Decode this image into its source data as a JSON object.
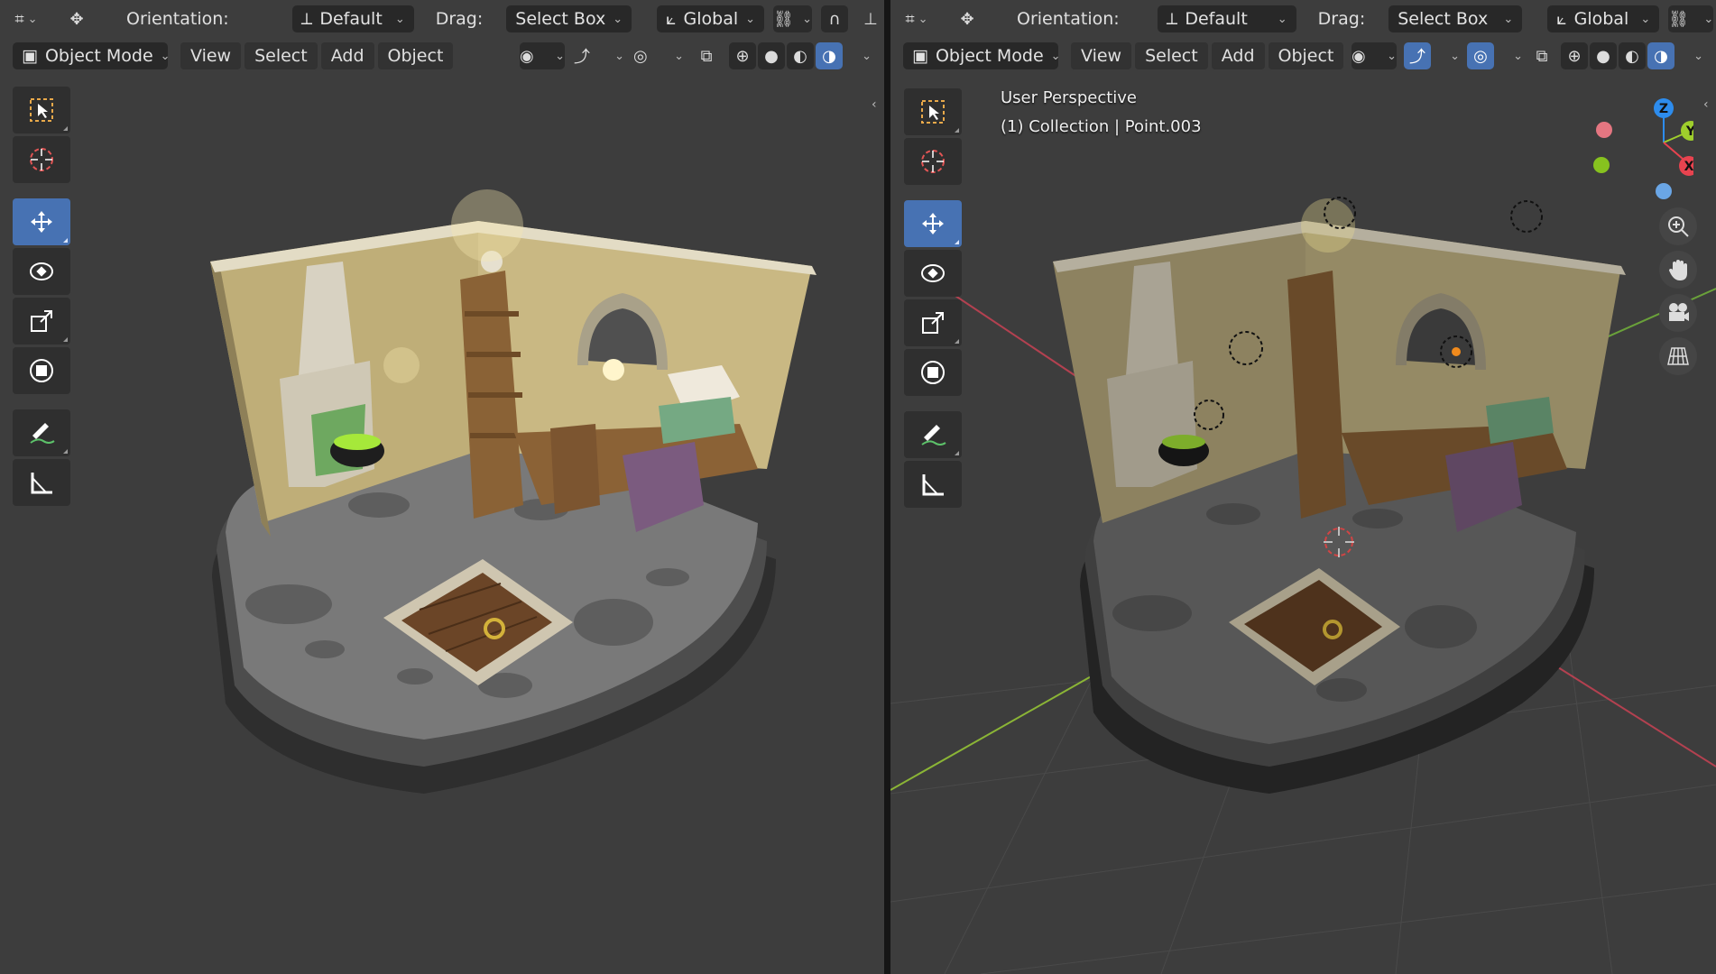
{
  "header": {
    "orientation_label": "Orientation:",
    "orientation_value": "Default",
    "drag_label": "Drag:",
    "drag_value": "Select Box",
    "transform_space": "Global"
  },
  "viewport_header": {
    "mode": "Object Mode",
    "menus": [
      "View",
      "Select",
      "Add",
      "Object"
    ]
  },
  "right_viewport": {
    "perspective_label": "User Perspective",
    "context_label": "(1) Collection | Point.003"
  },
  "gizmo": {
    "axes": [
      {
        "label": "X",
        "color": "#e8434f"
      },
      {
        "label": "Y",
        "color": "#9fce2c"
      },
      {
        "label": "Z",
        "color": "#2d8ced"
      }
    ]
  },
  "colors": {
    "accent": "#4772b3",
    "viewport_bg": "#3d3d3d",
    "header_bg": "#3d3d3d",
    "button_dark": "#282828"
  },
  "toolbar": {
    "tools": [
      "select-box-tool",
      "cursor-tool",
      "move-tool",
      "rotate-tool",
      "scale-tool",
      "transform-tool",
      "annotate-tool",
      "measure-tool"
    ]
  }
}
